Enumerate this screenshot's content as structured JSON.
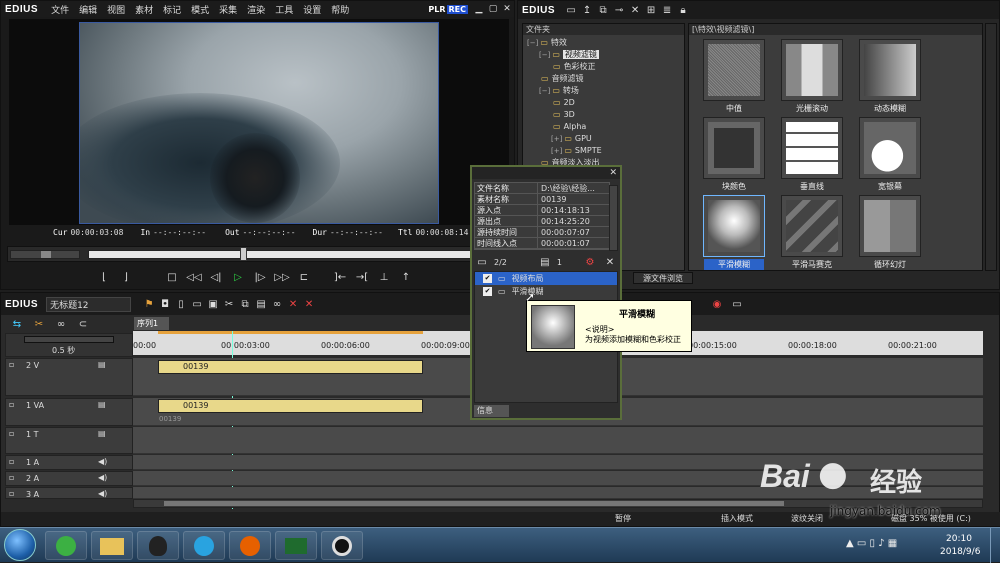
{
  "player": {
    "logo": "EDIUS",
    "menu": [
      "文件",
      "编辑",
      "视图",
      "素材",
      "标记",
      "模式",
      "采集",
      "渲染",
      "工具",
      "设置",
      "帮助"
    ],
    "plr": "PLR",
    "rec": "REC",
    "timecodes": {
      "cur_label": "Cur",
      "cur": "00:00:03:08",
      "in_label": "In",
      "in": "--:--:--:--",
      "out_label": "Out",
      "out": "--:--:--:--",
      "dur_label": "Dur",
      "dur": "--:--:--:--",
      "ttl_label": "Ttl",
      "ttl": "00:00:08:14"
    }
  },
  "effects_panel": {
    "logo": "EDIUS",
    "folder_header": "文件夹",
    "path": "[\\特效\\视频滤镜\\]",
    "tree": [
      {
        "label": "特效",
        "indent": 0,
        "toggle": "−"
      },
      {
        "label": "视频滤镜",
        "indent": 1,
        "toggle": "−",
        "selected": true
      },
      {
        "label": "色彩校正",
        "indent": 2,
        "toggle": ""
      },
      {
        "label": "音频滤镜",
        "indent": 1,
        "toggle": ""
      },
      {
        "label": "转场",
        "indent": 1,
        "toggle": "−"
      },
      {
        "label": "2D",
        "indent": 2,
        "toggle": ""
      },
      {
        "label": "3D",
        "indent": 2,
        "toggle": ""
      },
      {
        "label": "Alpha",
        "indent": 2,
        "toggle": ""
      },
      {
        "label": "GPU",
        "indent": 2,
        "toggle": "+"
      },
      {
        "label": "SMPTE",
        "indent": 2,
        "toggle": "+"
      },
      {
        "label": "音频淡入淡出",
        "indent": 1,
        "toggle": ""
      }
    ],
    "effects": [
      {
        "name": "中值",
        "icon": "noise"
      },
      {
        "name": "光栅滚动",
        "icon": "wave"
      },
      {
        "name": "动态模糊",
        "icon": "motion"
      },
      {
        "name": "块颜色",
        "icon": "block"
      },
      {
        "name": "垂直线",
        "icon": "grid"
      },
      {
        "name": "宽银幕",
        "icon": "cinema"
      },
      {
        "name": "平滑模糊",
        "icon": "smooth",
        "selected": true
      },
      {
        "name": "平滑马赛克",
        "icon": "mosaic"
      },
      {
        "name": "循环幻灯",
        "icon": "slide"
      }
    ],
    "bottom_tab": "源文件浏览"
  },
  "info_panel": {
    "properties": [
      {
        "k": "文件名称",
        "v": "D:\\经验\\经验..."
      },
      {
        "k": "素材名称",
        "v": "00139"
      },
      {
        "k": "源入点",
        "v": "00:14:18:13"
      },
      {
        "k": "源出点",
        "v": "00:14:25:20"
      },
      {
        "k": "源持续时间",
        "v": "00:00:07:07"
      },
      {
        "k": "时间线入点",
        "v": "00:00:01:07"
      }
    ],
    "count_a": "2/2",
    "count_b": "1",
    "filters": [
      {
        "label": "视频布局",
        "checked": true,
        "selected": true
      },
      {
        "label": "平滑模糊",
        "checked": true,
        "selected": false
      }
    ],
    "tab": "信息"
  },
  "tooltip": {
    "title": "平滑模糊",
    "desc_label": "<说明>",
    "desc": "为视频添加模糊和色彩校正"
  },
  "timeline": {
    "logo": "EDIUS",
    "project": "无标题12",
    "sequence_tab": "序列1",
    "scale": "0.5 秒",
    "ruler": [
      "00:00",
      "00:00:03:00",
      "00:00:06:00",
      "00:00:09:00",
      "00:00:15:00",
      "00:00:18:00",
      "00:00:21:00"
    ],
    "tracks": [
      {
        "name": "2 V",
        "clip": "00139"
      },
      {
        "name": "1 VA",
        "clip": "00139",
        "sub": "00139"
      },
      {
        "name": "1 T"
      },
      {
        "name": "1 A"
      },
      {
        "name": "2 A"
      },
      {
        "name": "3 A"
      }
    ],
    "status": {
      "pause": "暂停",
      "insert": "插入模式",
      "ripple": "波纹关闭",
      "disk": "磁盘 35% 被使用 (C:)"
    }
  },
  "watermark": {
    "brand": "Bai",
    "brand2": "经验",
    "url": "jingyan.baidu.com"
  },
  "taskbar": {
    "time": "20:10",
    "date": "2018/9/6"
  }
}
